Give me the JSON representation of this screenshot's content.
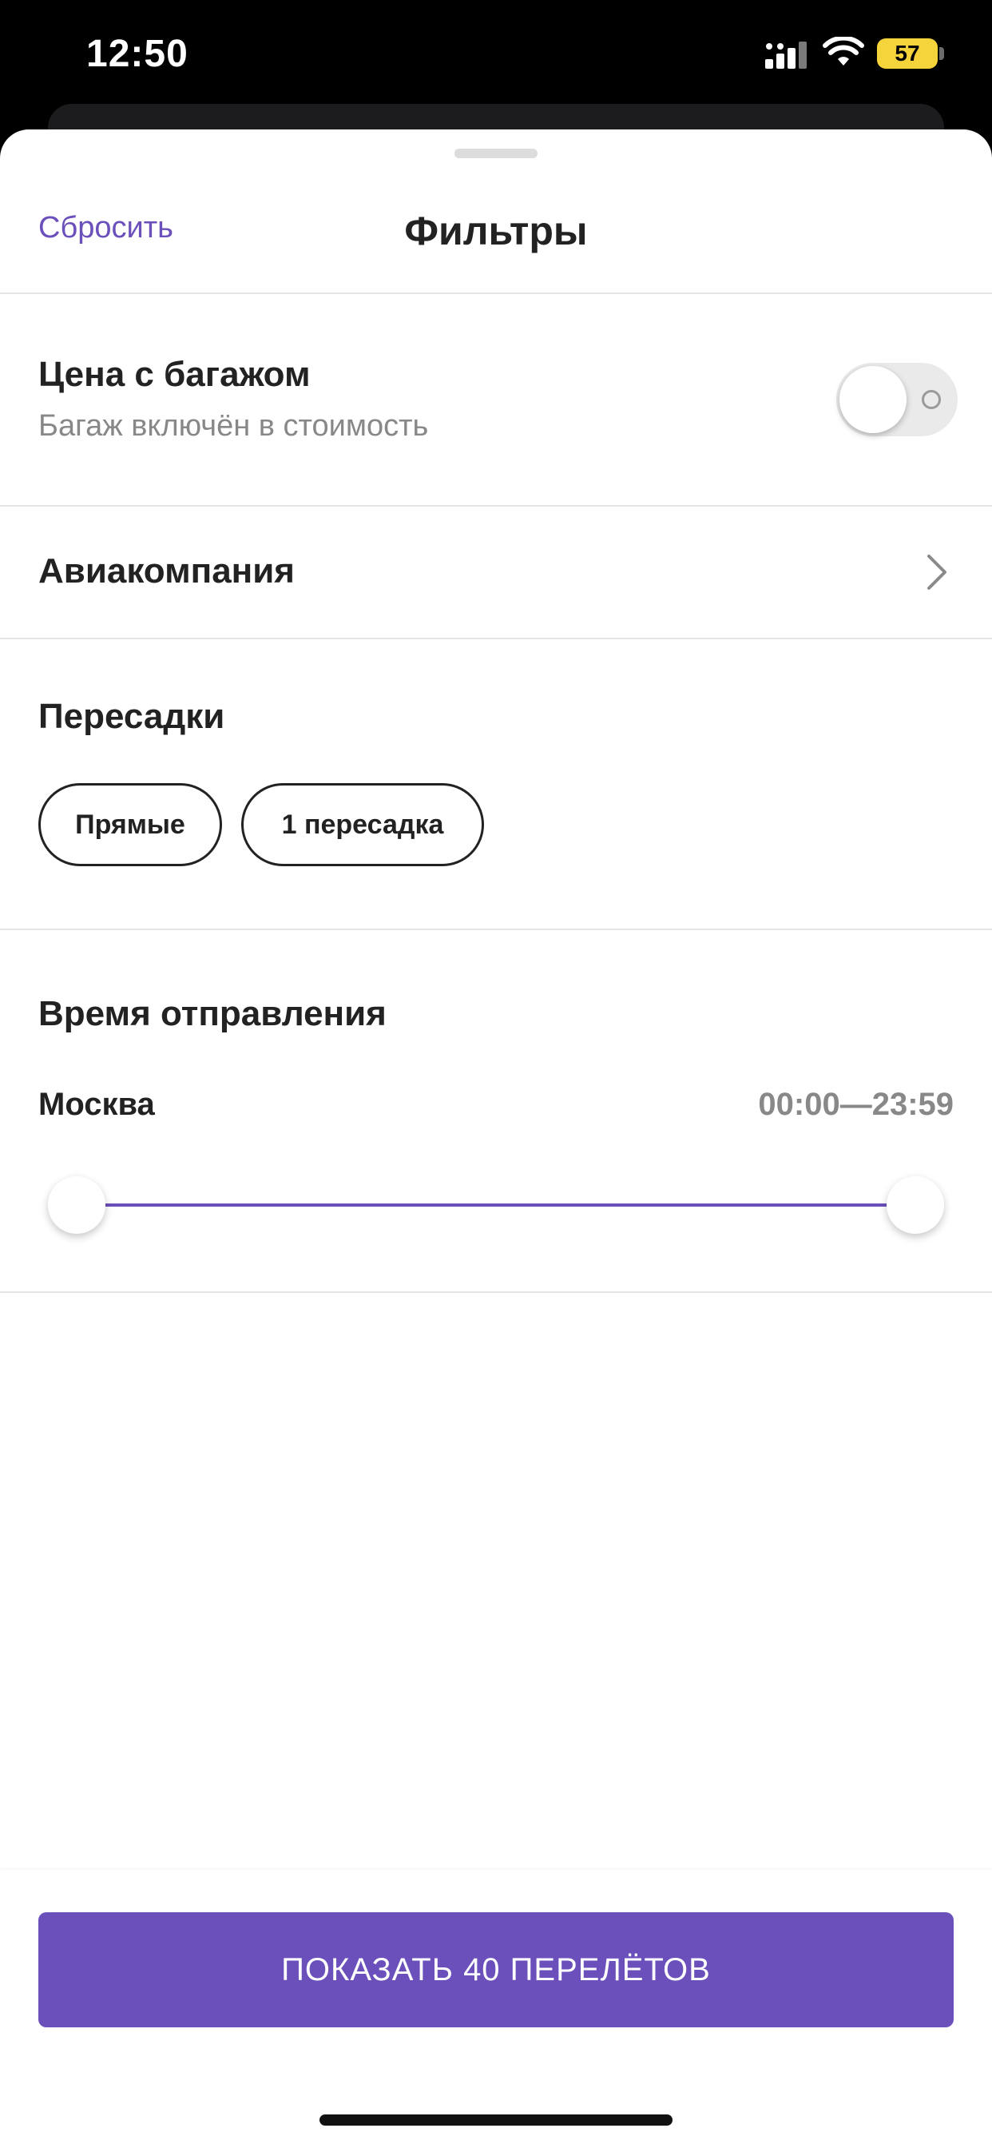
{
  "status_bar": {
    "time": "12:50",
    "battery": "57",
    "icons": [
      "signal-icon",
      "wifi-icon",
      "battery-icon"
    ]
  },
  "header": {
    "reset_label": "Сбросить",
    "title": "Фильтры"
  },
  "baggage": {
    "title": "Цена с багажом",
    "subtitle": "Багаж включён в стоимость",
    "toggle_on": false
  },
  "airline": {
    "label": "Авиакомпания"
  },
  "transfers": {
    "title": "Пересадки",
    "options": [
      {
        "label": "Прямые"
      },
      {
        "label": "1 пересадка"
      }
    ]
  },
  "departure": {
    "title": "Время отправления",
    "city": "Москва",
    "range": "00:00—23:59",
    "slider_min_fraction": 0,
    "slider_max_fraction": 1
  },
  "footer": {
    "show_button": "ПОКАЗАТЬ 40 ПЕРЕЛЁТОВ"
  },
  "colors": {
    "accent": "#6b4fbb",
    "battery": "#f5d33a"
  }
}
